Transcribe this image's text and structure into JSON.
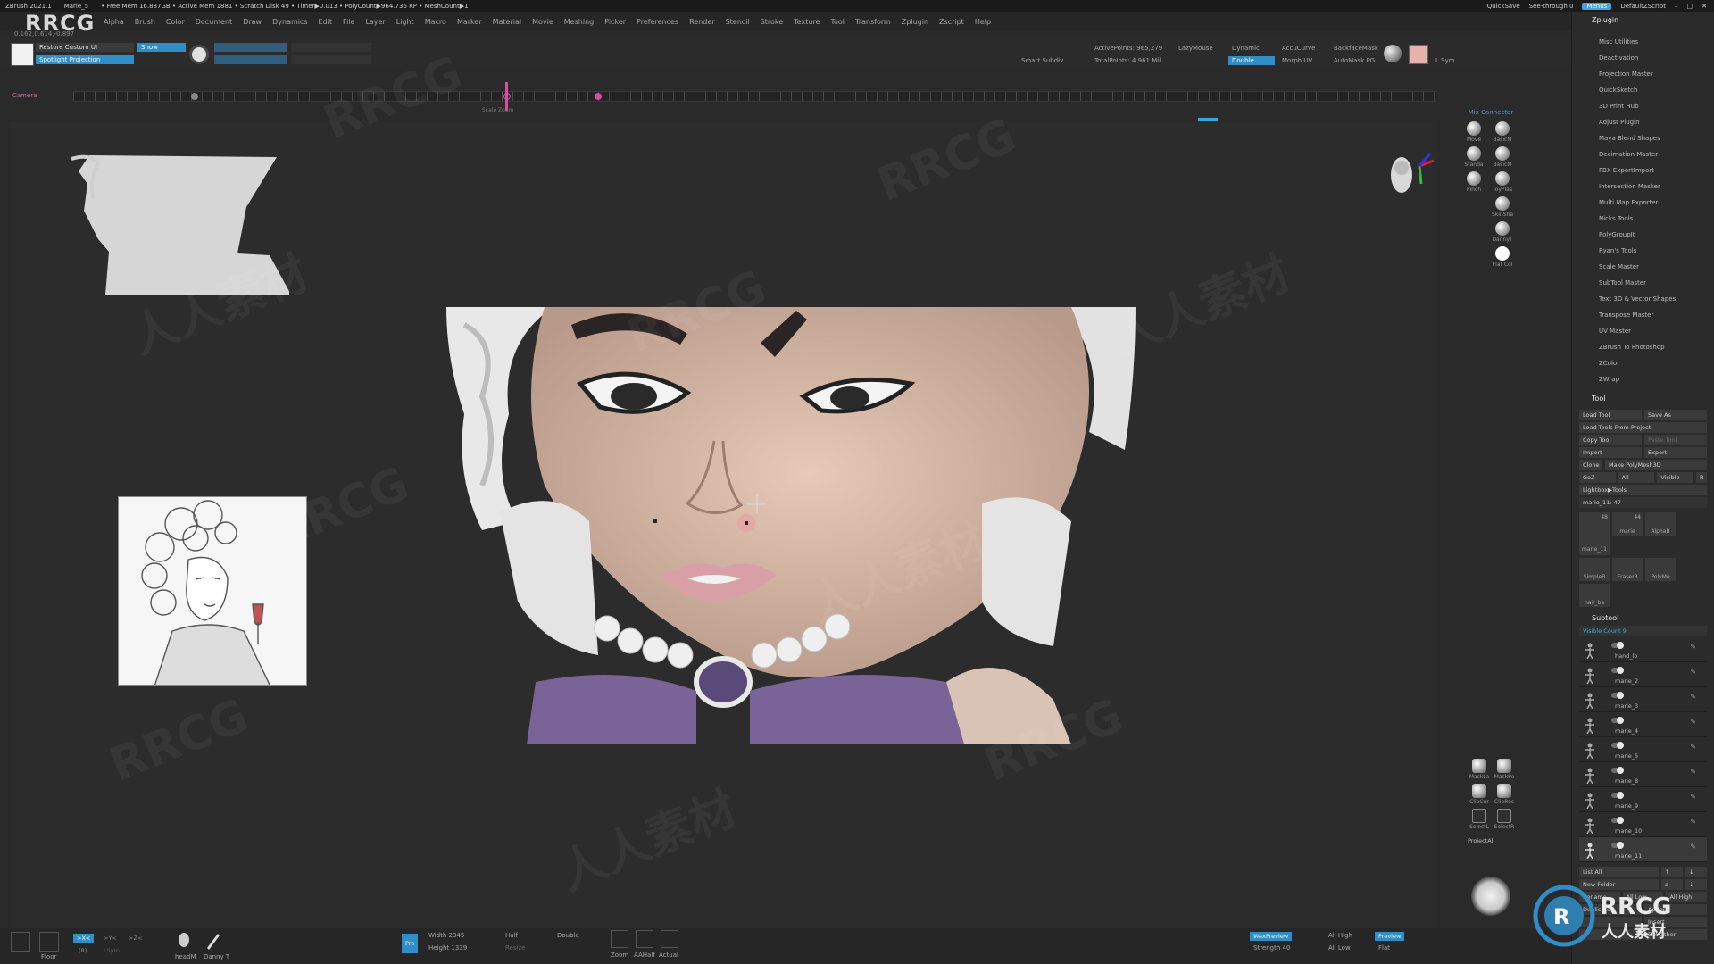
{
  "title_bar": {
    "app": "ZBrush 2021.1",
    "doc": "Marie_5",
    "stats": "• Free Mem 16.887GB • Active Mem 1881 • Scratch Disk 49 • Timer▶0.013 • PolyCount▶964.736 KP • MeshCount▶1",
    "quicksave": "QuickSave",
    "see_through": "See-through  0",
    "menus": "Menus",
    "script": "DefaultZScript"
  },
  "menubar": {
    "items": [
      "Alpha",
      "Brush",
      "Color",
      "Document",
      "Draw",
      "Dynamics",
      "Edit",
      "File",
      "Layer",
      "Light",
      "Macro",
      "Marker",
      "Material",
      "Movie",
      "Meshing",
      "Picker",
      "Preferences",
      "Render",
      "Stencil",
      "Stroke",
      "Texture",
      "Tool",
      "Transform",
      "Zplugin",
      "Zscript",
      "Help"
    ]
  },
  "logo": "RRCG",
  "coords": "0.162,0.614,-0.897",
  "top_shelf": {
    "restore_custom_ui": "Restore Custom UI",
    "show": "Show",
    "spotlight_projection": "Spotlight Projection",
    "smart_subdiv": "Smart Subdiv",
    "active_points": "ActivePoints: 965,279",
    "total_points": "TotalPoints: 4.961 Mil",
    "lazymouse": "LazyMouse",
    "dynamic": "Dynamic",
    "double": "Double",
    "accucurve": "AccuCurve",
    "morph_uv": "Morph UV",
    "backface_mask": "BackfaceMask",
    "automask_pg": "AutoMask PG",
    "l_sym": "L.Sym"
  },
  "timeline": {
    "label": "Camera",
    "sublabel": "Scale Zoom"
  },
  "brush_palette": {
    "header": "Mix Connector",
    "brushes": [
      "Move",
      "BasicM",
      "Standa",
      "BasicM",
      "Pinch",
      "ToyPlas",
      "SkinSha",
      "DannyT",
      "Flat Col"
    ]
  },
  "mask_palette": {
    "items": [
      "MaskLa",
      "MaskPe",
      "ClipCur",
      "ClipRec",
      "SelectL",
      "SelectR",
      "ProjectAll"
    ]
  },
  "zplugin": {
    "header": "Zplugin",
    "items": [
      "Misc Utilities",
      "Deactivation",
      "Projection Master",
      "QuickSketch",
      "3D Print Hub",
      "Adjust Plugin",
      "Maya Blend Shapes",
      "Decimation Master",
      "FBX ExportImport",
      "Intersection Masker",
      "Multi Map Exporter",
      "Nicks Tools",
      "PolyGroupIt",
      "Ryan's Tools",
      "Scale Master",
      "SubTool Master",
      "Text 3D & Vector Shapes",
      "Transpose Master",
      "UV Master",
      "ZBrush To Photoshop",
      "ZColor",
      "ZWrap"
    ]
  },
  "tool": {
    "header": "Tool",
    "load_tool": "Load Tool",
    "save_as": "Save As",
    "load_from_project": "Load Tools From Project",
    "copy_tool": "Copy Tool",
    "paste_tool": "Paste Tool",
    "import": "Import",
    "export": "Export",
    "clone": "Clone",
    "make_polymesh": "Make PolyMesh3D",
    "goz": "GoZ",
    "all": "All",
    "visible": "Visible",
    "r": "R",
    "lightbox_tools": "Lightbox▶Tools",
    "current_tool": "marie_11: 47",
    "thumbs": [
      "marie_11",
      "marie",
      "AlphaB",
      "SimpleB",
      "EraserB",
      "PolyMe",
      "hair_ba"
    ],
    "thumb_counts": [
      "48",
      "44"
    ]
  },
  "subtool": {
    "header": "Subtool",
    "visible_count": "Visible Count  9",
    "items": [
      "hand_lo",
      "marie_2",
      "marie_3",
      "marie_4",
      "marie_5",
      "marie_8",
      "marie_9",
      "marie_10",
      "marie_11"
    ],
    "list_all": "List All",
    "new_folder": "New Folder",
    "rename": "Rename",
    "all_low": "All Low",
    "all_high": "All High",
    "duplicate": "Duplicate",
    "insert": "Insert",
    "del_other": "Del Other",
    "append": "Append"
  },
  "bottom_bar": {
    "floor": "Floor",
    "xsym": ">X<",
    "ysym": ">Y<",
    "zsym": ">Z<",
    "r": "(R)",
    "local_sym": "LSym",
    "brushes": [
      "headM",
      "Danny T"
    ],
    "pro": "Pro",
    "width": "Width 2345",
    "height": "Height 1339",
    "half": "Half",
    "double": "Double",
    "resize": "Resize",
    "zoom": "Zoom",
    "aahalf": "AAHalf",
    "actual": "Actual",
    "wax_preview": "WaxPreview",
    "strength": "Strength 40",
    "all_high": "All High",
    "all_low": "All Low",
    "preview": "Preview",
    "flat": "Flat"
  },
  "watermarks": [
    "RRCG",
    "人人素材"
  ],
  "bottom_logo": {
    "big": "RRCG",
    "small": "人人素材"
  },
  "colors": {
    "accent_blue": "#2f8dc8",
    "timeline_pink": "#d94ba4",
    "bg": "#2a2a2a"
  }
}
